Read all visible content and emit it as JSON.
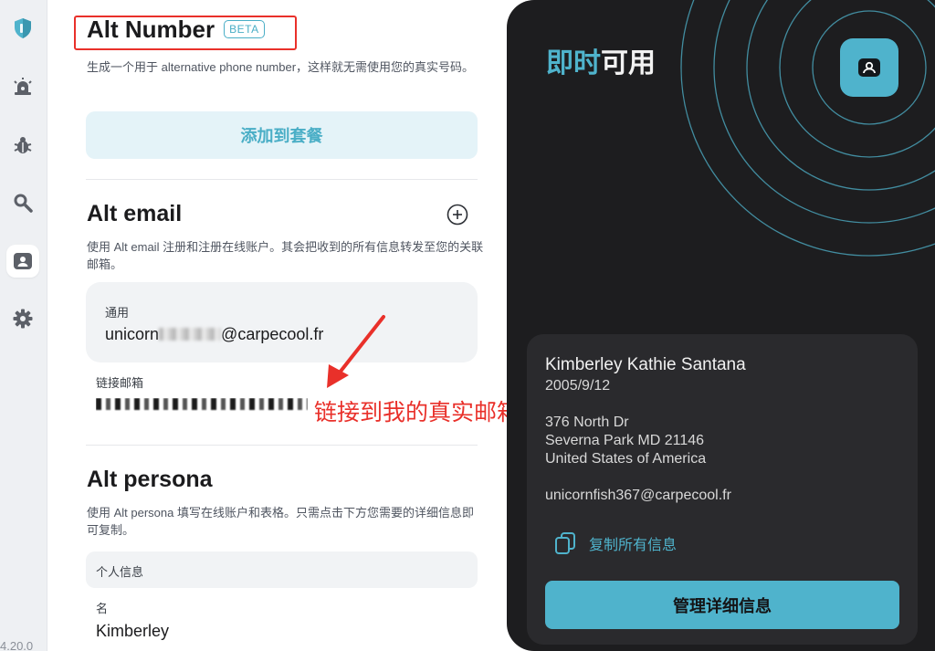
{
  "version": "4.20.0",
  "colors": {
    "accent": "#4fb3cc",
    "annotation": "#e9302a",
    "panel_bg": "#1d1d1f"
  },
  "sidebar": {
    "items": [
      {
        "name": "shield-icon"
      },
      {
        "name": "alarm-icon"
      },
      {
        "name": "bug-icon"
      },
      {
        "name": "search-icon"
      },
      {
        "name": "persona-icon",
        "active": true
      },
      {
        "name": "gear-icon"
      }
    ]
  },
  "alt_number": {
    "title": "Alt Number",
    "badge": "BETA",
    "description": "生成一个用于 alternative phone number，这样就无需使用您的真实号码。",
    "button": "添加到套餐"
  },
  "alt_email": {
    "title": "Alt email",
    "description": "使用 Alt email 注册和注册在线账户。其会把收到的所有信息转发至您的关联邮箱。",
    "card_label": "通用",
    "email_prefix": "unicorn",
    "email_suffix": "@carpecool.fr",
    "linked_label": "链接邮箱"
  },
  "alt_persona": {
    "title": "Alt persona",
    "description": "使用 Alt persona 填写在线账户和表格。只需点击下方您需要的详细信息即可复制。",
    "section_label": "个人信息",
    "field_label": "名",
    "field_value": "Kimberley"
  },
  "annotation": {
    "text": "链接到我的真实邮箱"
  },
  "panel": {
    "title_accent": "即时",
    "title_rest": "可用",
    "persona": {
      "name": "Kimberley Kathie Santana",
      "birthdate": "2005/9/12",
      "address_line1": "376 North Dr",
      "address_line2": "Severna Park MD 21146",
      "country": "United States of America",
      "email": "unicornfish367@carpecool.fr"
    },
    "copy_all": "复制所有信息",
    "manage_button": "管理详细信息"
  }
}
